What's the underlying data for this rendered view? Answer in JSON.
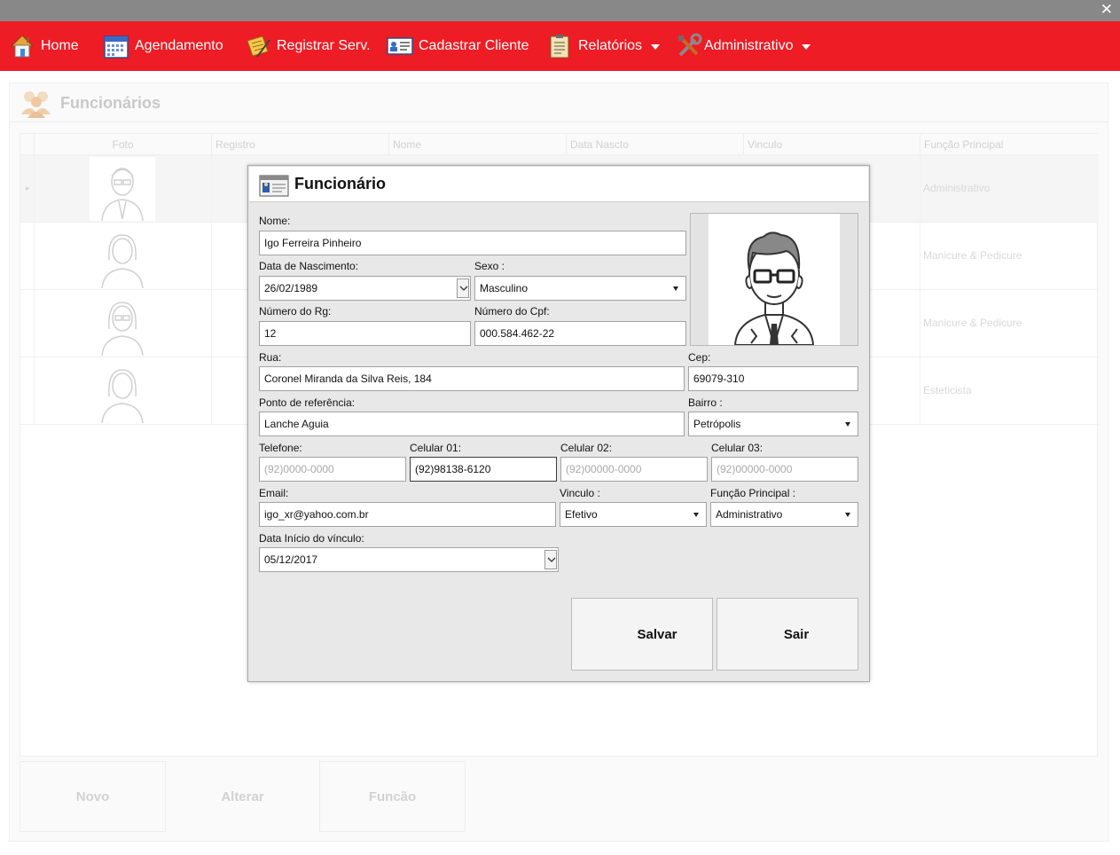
{
  "window": {
    "close_glyph": "✕"
  },
  "menu": {
    "home": "Home",
    "agendamento": "Agendamento",
    "registrar": "Registrar Serv.",
    "cadastrar": "Cadastrar Cliente",
    "relatorios": "Relatórios",
    "administrativo": "Administrativo"
  },
  "background": {
    "title": "Funcionários",
    "columns": [
      "Foto",
      "Registro",
      "Nome",
      "Data Nascto",
      "Vinculo",
      "Função Principal"
    ],
    "rows": [
      {
        "funcao": "Administrativo"
      },
      {
        "funcao": "Manicure & Pedicure"
      },
      {
        "funcao": "Manicure & Pedicure"
      },
      {
        "funcao": "Esteticista"
      }
    ],
    "buttons": {
      "novo": "Novo",
      "alterar": "Alterar",
      "funcao": "Funcão"
    }
  },
  "dialog": {
    "title": "Funcionário",
    "labels": {
      "nome": "Nome:",
      "nascimento": "Data de Nascimento:",
      "sexo": "Sexo :",
      "rg": "Número do Rg:",
      "cpf": "Número do Cpf:",
      "rua": "Rua:",
      "cep": "Cep:",
      "referencia": "Ponto de referência:",
      "bairro": "Bairro :",
      "telefone": "Telefone:",
      "celular1": "Celular 01:",
      "celular2": "Celular 02:",
      "celular3": "Celular 03:",
      "email": "Email:",
      "vinculo": "Vinculo :",
      "funcao": "Função Principal :",
      "inicio": "Data Início do vínculo:"
    },
    "values": {
      "nome": "Igo Ferreira Pinheiro",
      "nascimento": "26/02/1989",
      "sexo": "Masculino",
      "rg": "12",
      "cpf": "000.584.462-22",
      "rua": "Coronel Miranda da Silva Reis, 184",
      "cep": "69079-310",
      "referencia": "Lanche Aguia",
      "bairro": "Petrópolis",
      "celular1": "(92)98138-6120",
      "email": "igo_xr@yahoo.com.br",
      "vinculo": "Efetivo",
      "funcao": "Administrativo",
      "inicio": "05/12/2017"
    },
    "placeholders": {
      "telefone": "(92)0000-0000",
      "celular2": "(92)00000-0000",
      "celular3": "(92)00000-0000"
    },
    "buttons": {
      "salvar": "Salvar",
      "sair": "Sair"
    }
  },
  "colors": {
    "menu_bg": "#ee1c25",
    "titlebar": "#888888"
  }
}
